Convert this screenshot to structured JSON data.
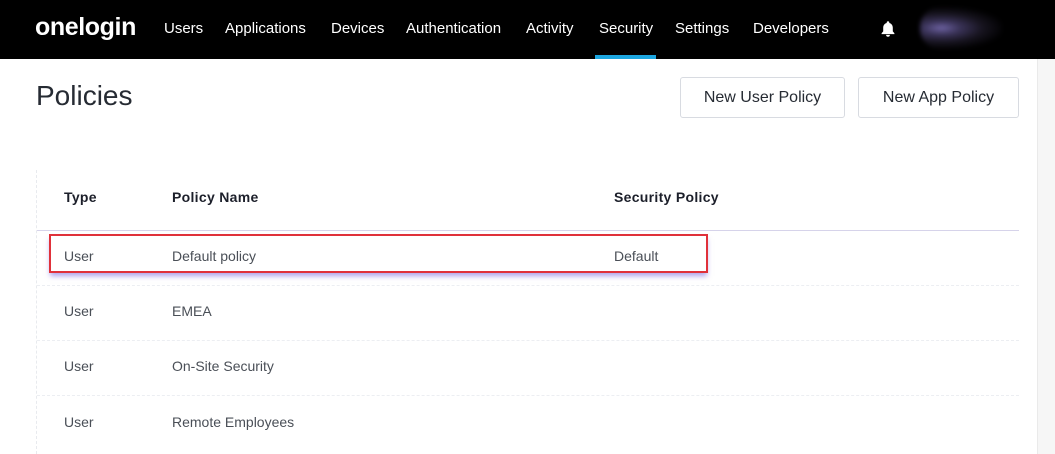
{
  "nav": {
    "logo": "onelogin",
    "items": [
      {
        "label": "Users"
      },
      {
        "label": "Applications"
      },
      {
        "label": "Devices"
      },
      {
        "label": "Authentication"
      },
      {
        "label": "Activity"
      },
      {
        "label": "Security",
        "active": true
      },
      {
        "label": "Settings"
      },
      {
        "label": "Developers"
      }
    ],
    "bell_icon": "bell-icon",
    "accent_color": "#1ca6e0"
  },
  "page": {
    "title": "Policies",
    "buttons": {
      "new_user_policy": "New User Policy",
      "new_app_policy": "New App Policy"
    }
  },
  "table": {
    "columns": [
      "Type",
      "Policy Name",
      "Security Policy"
    ],
    "rows": [
      {
        "type": "User",
        "name": "Default policy",
        "security": "Default",
        "highlighted": true
      },
      {
        "type": "User",
        "name": "EMEA",
        "security": ""
      },
      {
        "type": "User",
        "name": "On-Site Security",
        "security": ""
      },
      {
        "type": "User",
        "name": "Remote Employees",
        "security": ""
      }
    ]
  },
  "colors": {
    "nav_background": "#000000",
    "highlight_border": "#e0313a"
  }
}
